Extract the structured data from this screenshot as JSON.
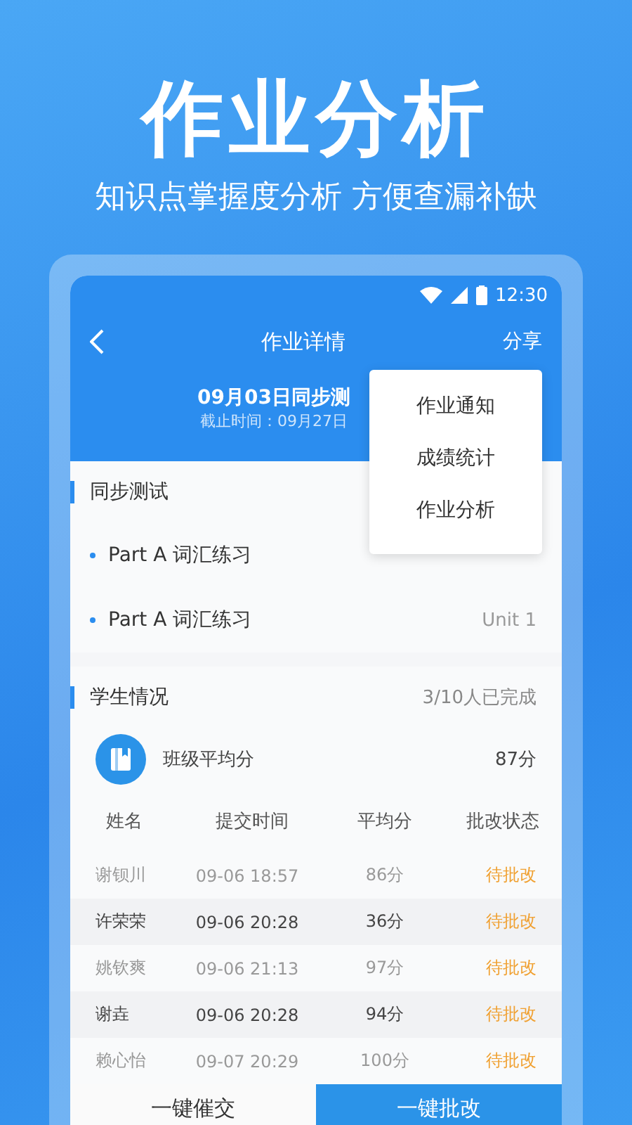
{
  "headline": "作业分析",
  "subheadline": "知识点掌握度分析 方便查漏补缺",
  "status_bar": {
    "time": "12:30"
  },
  "nav": {
    "title": "作业详情",
    "action": "分享"
  },
  "assignment": {
    "title": "09月03日同步测",
    "deadline": "截止时间：09月27日"
  },
  "menu": {
    "items": [
      {
        "label": "作业通知"
      },
      {
        "label": "成绩统计"
      },
      {
        "label": "作业分析"
      }
    ]
  },
  "sync_test": {
    "heading": "同步测试",
    "items": [
      {
        "label": "Part A 词汇练习"
      },
      {
        "label": "Part A 词汇练习",
        "unit": "Unit 1"
      }
    ]
  },
  "students": {
    "heading": "学生情况",
    "progress": "3/10人已完成",
    "average_label": "班级平均分",
    "average": "87分",
    "columns": [
      "姓名",
      "提交时间",
      "平均分",
      "批改状态"
    ],
    "rows": [
      {
        "name": "谢钡川",
        "time": "09-06  18:57",
        "score": "86分",
        "status": "待批改"
      },
      {
        "name": "许荣荣",
        "time": "09-06  20:28",
        "score": "36分",
        "status": "待批改"
      },
      {
        "name": "姚钦爽",
        "time": "09-06  21:13",
        "score": "97分",
        "status": "待批改"
      },
      {
        "name": "谢垚",
        "time": "09-06  20:28",
        "score": "94分",
        "status": "待批改"
      },
      {
        "name": "赖心怡",
        "time": "09-07  20:29",
        "score": "100分",
        "status": "待批改"
      }
    ]
  },
  "buttons": [
    {
      "label": "一键催交",
      "primary": false
    },
    {
      "label": "一键批改",
      "primary": true
    }
  ]
}
